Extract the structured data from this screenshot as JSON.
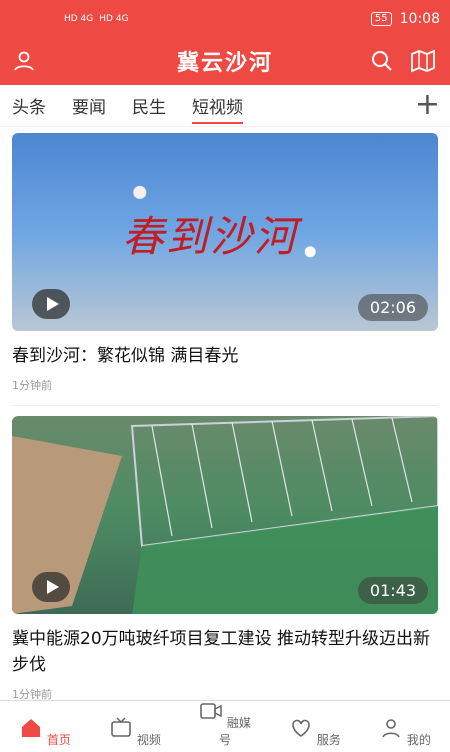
{
  "status": {
    "network1": "HD 4G",
    "network2": "HD 4G",
    "battery": "55",
    "time": "10:08"
  },
  "header": {
    "title": "冀云沙河"
  },
  "tabs": [
    {
      "label": "头条",
      "active": false
    },
    {
      "label": "要闻",
      "active": false
    },
    {
      "label": "民生",
      "active": false
    },
    {
      "label": "短视频",
      "active": true
    }
  ],
  "add_label": "+",
  "videos": [
    {
      "overlay_text": "春到沙河",
      "duration": "02:06",
      "title": "春到沙河：繁花似锦 满目春光",
      "time": "1分钟前"
    },
    {
      "overlay_text": "",
      "duration": "01:43",
      "title": "冀中能源20万吨玻纤项目复工建设 推动转型升级迈出新步伐",
      "time": "1分钟前"
    }
  ],
  "bottom_nav": [
    {
      "label": "首页",
      "icon": "home-icon",
      "active": true
    },
    {
      "label": "视频",
      "icon": "tv-icon",
      "active": false
    },
    {
      "label": "融媒号",
      "icon": "video-icon",
      "active": false
    },
    {
      "label": "服务",
      "icon": "heart-icon",
      "active": false
    },
    {
      "label": "我的",
      "icon": "user-icon",
      "active": false
    }
  ],
  "colors": {
    "brand": "#ee4a43"
  }
}
